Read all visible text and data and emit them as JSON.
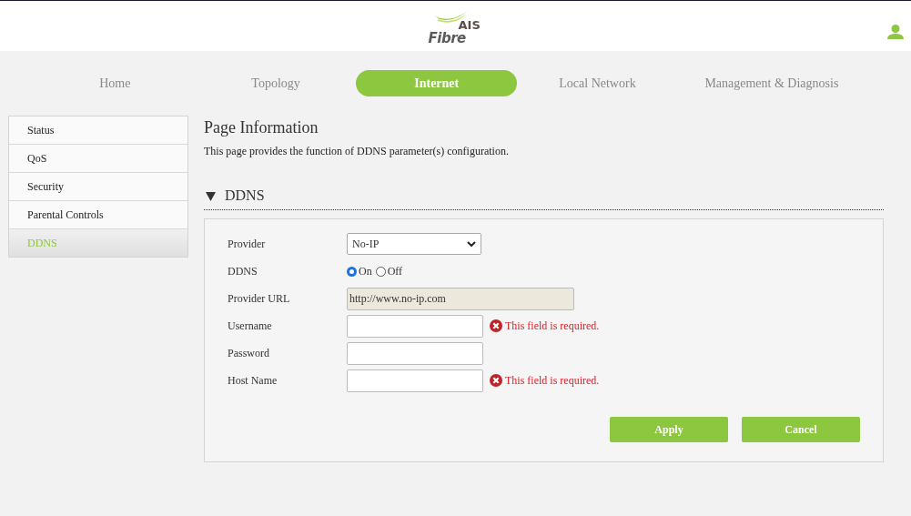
{
  "logo": {
    "brand": "AIS",
    "product": "Fibre"
  },
  "tabs": [
    {
      "label": "Home",
      "selected": false
    },
    {
      "label": "Topology",
      "selected": false
    },
    {
      "label": "Internet",
      "selected": true
    },
    {
      "label": "Local Network",
      "selected": false
    },
    {
      "label": "Management & Diagnosis",
      "selected": false
    }
  ],
  "sidebar": {
    "items": [
      {
        "label": "Status",
        "selected": false
      },
      {
        "label": "QoS",
        "selected": false
      },
      {
        "label": "Security",
        "selected": false
      },
      {
        "label": "Parental Controls",
        "selected": false
      },
      {
        "label": "DDNS",
        "selected": true
      }
    ]
  },
  "page_title": "Page Information",
  "description": "This page provides the function of DDNS parameter(s) configuration.",
  "section": {
    "title": "DDNS",
    "expanded": true
  },
  "form": [
    {
      "kind": "select",
      "label": "Provider",
      "value": "No-IP"
    },
    {
      "kind": "radio",
      "label": "DDNS",
      "options": [
        {
          "label": "On",
          "selected": true
        },
        {
          "label": "Off",
          "selected": false
        }
      ]
    },
    {
      "kind": "readonly",
      "label": "Provider URL",
      "value": "http://www.no-ip.com"
    },
    {
      "kind": "text",
      "label": "Username",
      "error": "This field is required."
    },
    {
      "kind": "password",
      "label": "Password"
    },
    {
      "kind": "text",
      "label": "Host Name",
      "error": "This field is required."
    }
  ],
  "buttons": [
    "Apply",
    "Cancel"
  ]
}
